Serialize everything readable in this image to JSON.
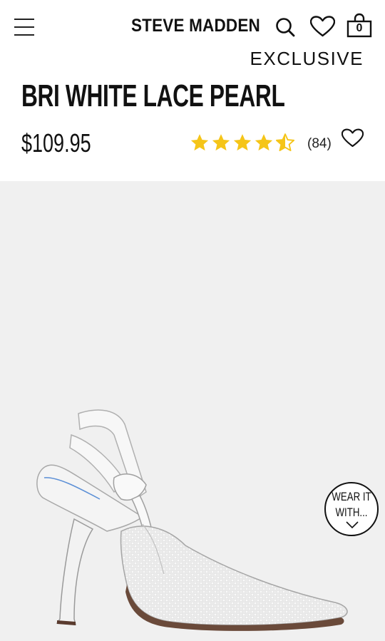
{
  "header": {
    "logo": "STEVE MADDEN",
    "bag_count": "0",
    "icons": [
      "menu-icon",
      "search-icon",
      "heart-icon",
      "shopping-bag-icon"
    ]
  },
  "product": {
    "badge": "EXCLUSIVE",
    "name": "BRI WHITE LACE PEARL",
    "price": "$109.95",
    "rating": 4.5,
    "rating_max": 5,
    "review_count": "(84)",
    "star_color": "#F5C518"
  },
  "wear_it": {
    "line1": "WEAR IT",
    "line2": "WITH..."
  }
}
